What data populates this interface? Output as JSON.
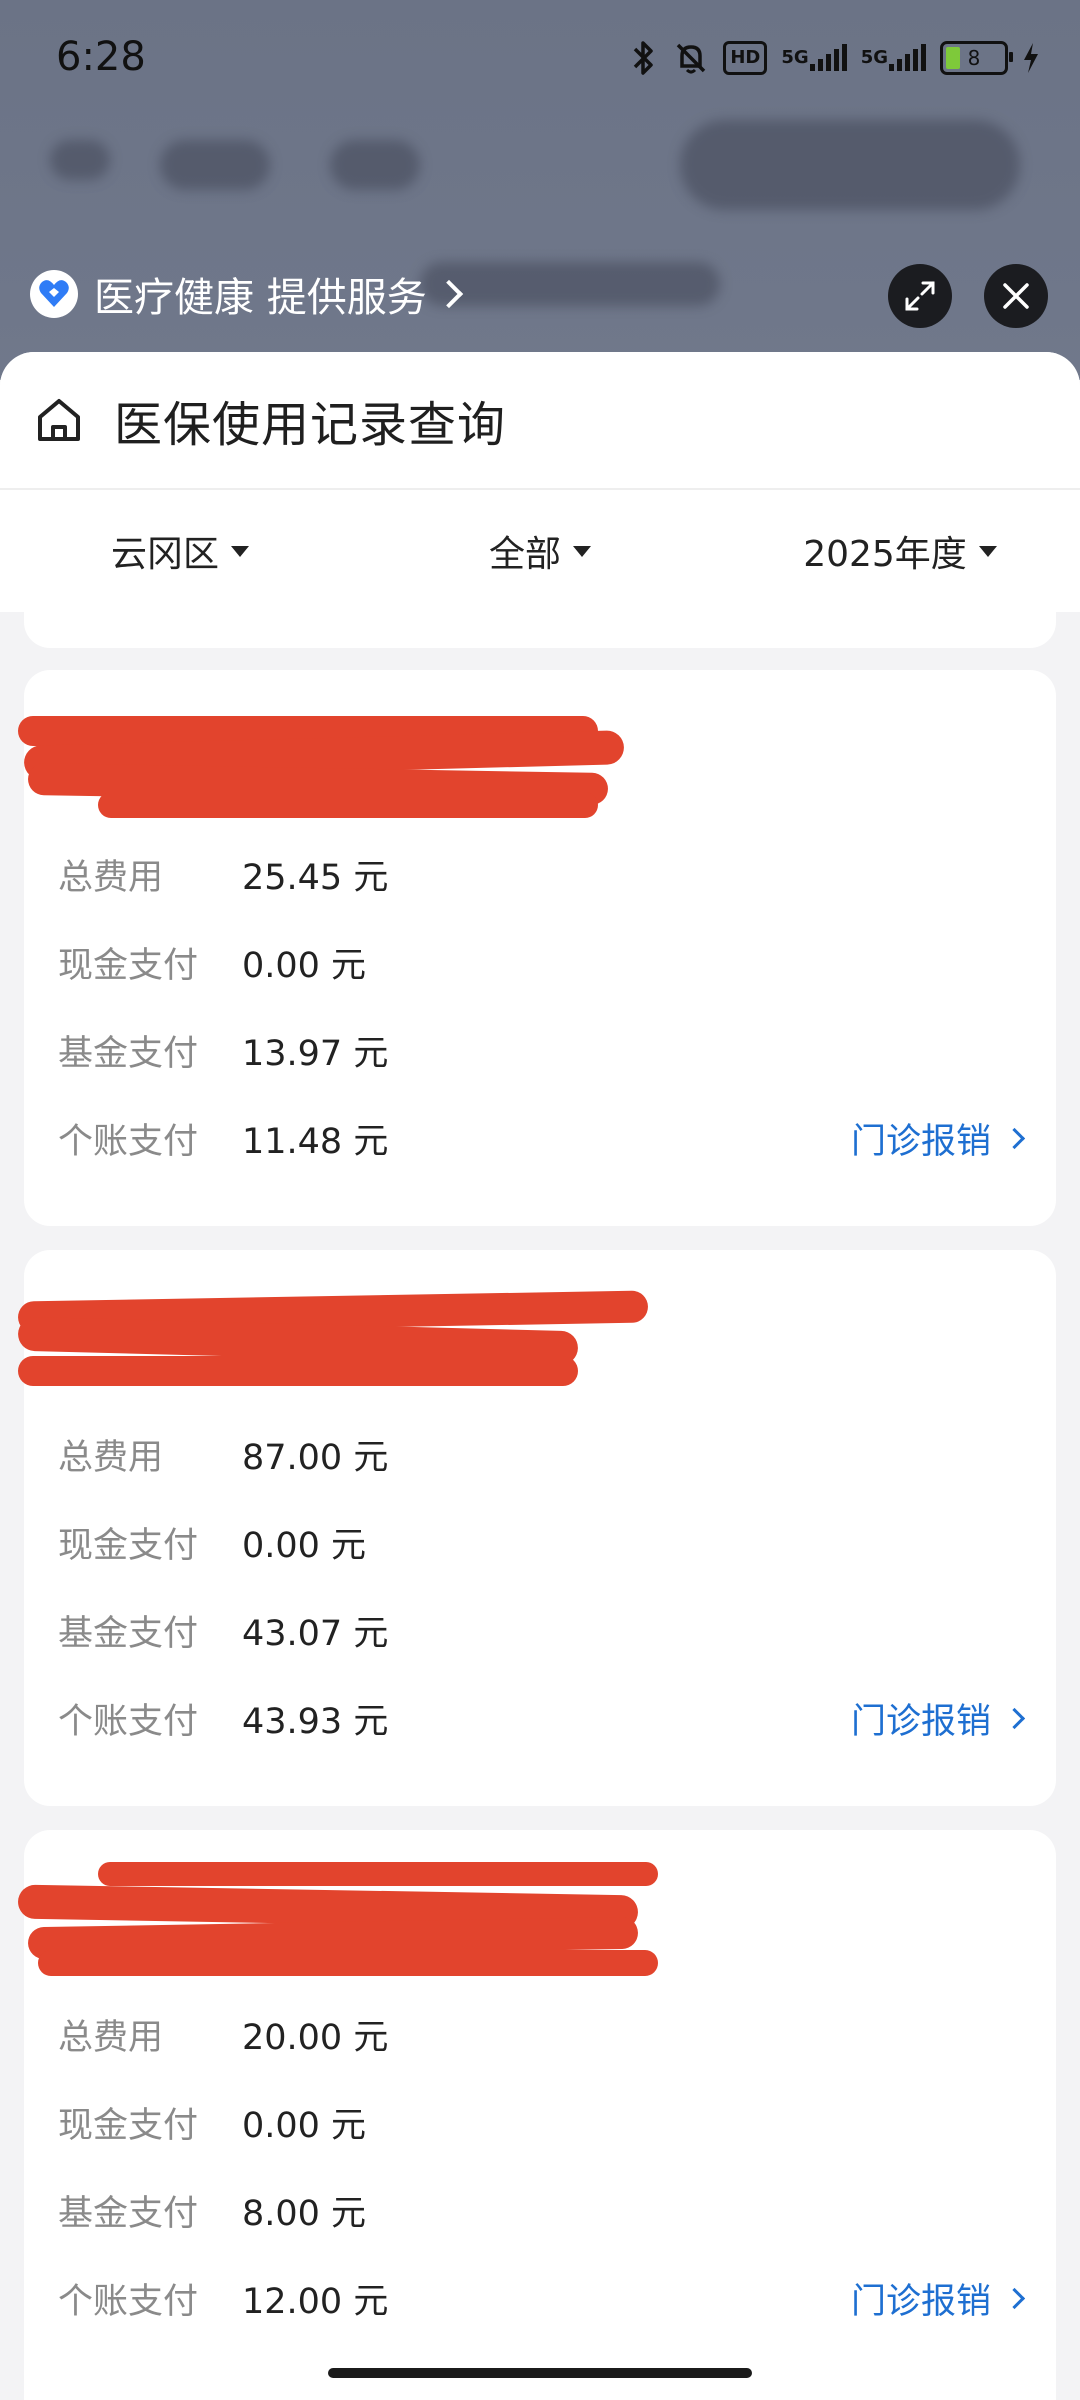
{
  "status_bar": {
    "time": "6:28",
    "hd_label": "HD",
    "sim1_label": "5G",
    "sim2_label": "5G",
    "battery_level": "8"
  },
  "provider": {
    "label": "医疗健康 提供服务"
  },
  "sheet": {
    "title": "医保使用记录查询"
  },
  "filters": {
    "region": "云冈区",
    "type": "全部",
    "year": "2025年度"
  },
  "records": [
    {
      "total_label": "总费用",
      "total": "25.45 元",
      "cash_label": "现金支付",
      "cash": "0.00 元",
      "fund_label": "基金支付",
      "fund": "13.97 元",
      "personal_label": "个账支付",
      "personal": "11.48 元",
      "claim_label": "门诊报销"
    },
    {
      "total_label": "总费用",
      "total": "87.00 元",
      "cash_label": "现金支付",
      "cash": "0.00 元",
      "fund_label": "基金支付",
      "fund": "43.07 元",
      "personal_label": "个账支付",
      "personal": "43.93 元",
      "claim_label": "门诊报销"
    },
    {
      "total_label": "总费用",
      "total": "20.00 元",
      "cash_label": "现金支付",
      "cash": "0.00 元",
      "fund_label": "基金支付",
      "fund": "8.00 元",
      "personal_label": "个账支付",
      "personal": "12.00 元",
      "claim_label": "门诊报销"
    }
  ],
  "colors": {
    "accent": "#1e6fd1",
    "redaction": "#e2442d"
  }
}
